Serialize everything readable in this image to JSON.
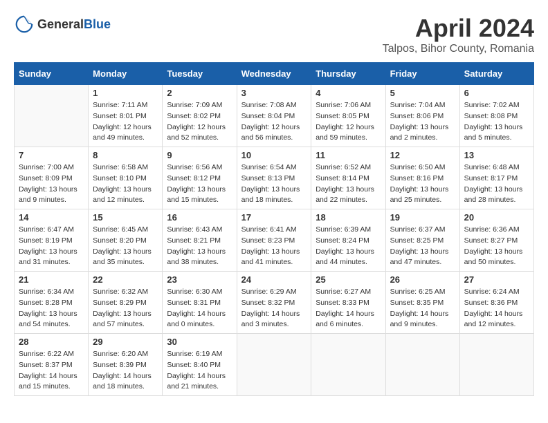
{
  "header": {
    "logo_general": "General",
    "logo_blue": "Blue",
    "month_title": "April 2024",
    "location": "Talpos, Bihor County, Romania"
  },
  "days_of_week": [
    "Sunday",
    "Monday",
    "Tuesday",
    "Wednesday",
    "Thursday",
    "Friday",
    "Saturday"
  ],
  "weeks": [
    [
      {
        "day": "",
        "sunrise": "",
        "sunset": "",
        "daylight": "",
        "empty": true
      },
      {
        "day": "1",
        "sunrise": "Sunrise: 7:11 AM",
        "sunset": "Sunset: 8:01 PM",
        "daylight": "Daylight: 12 hours and 49 minutes."
      },
      {
        "day": "2",
        "sunrise": "Sunrise: 7:09 AM",
        "sunset": "Sunset: 8:02 PM",
        "daylight": "Daylight: 12 hours and 52 minutes."
      },
      {
        "day": "3",
        "sunrise": "Sunrise: 7:08 AM",
        "sunset": "Sunset: 8:04 PM",
        "daylight": "Daylight: 12 hours and 56 minutes."
      },
      {
        "day": "4",
        "sunrise": "Sunrise: 7:06 AM",
        "sunset": "Sunset: 8:05 PM",
        "daylight": "Daylight: 12 hours and 59 minutes."
      },
      {
        "day": "5",
        "sunrise": "Sunrise: 7:04 AM",
        "sunset": "Sunset: 8:06 PM",
        "daylight": "Daylight: 13 hours and 2 minutes."
      },
      {
        "day": "6",
        "sunrise": "Sunrise: 7:02 AM",
        "sunset": "Sunset: 8:08 PM",
        "daylight": "Daylight: 13 hours and 5 minutes."
      }
    ],
    [
      {
        "day": "7",
        "sunrise": "Sunrise: 7:00 AM",
        "sunset": "Sunset: 8:09 PM",
        "daylight": "Daylight: 13 hours and 9 minutes."
      },
      {
        "day": "8",
        "sunrise": "Sunrise: 6:58 AM",
        "sunset": "Sunset: 8:10 PM",
        "daylight": "Daylight: 13 hours and 12 minutes."
      },
      {
        "day": "9",
        "sunrise": "Sunrise: 6:56 AM",
        "sunset": "Sunset: 8:12 PM",
        "daylight": "Daylight: 13 hours and 15 minutes."
      },
      {
        "day": "10",
        "sunrise": "Sunrise: 6:54 AM",
        "sunset": "Sunset: 8:13 PM",
        "daylight": "Daylight: 13 hours and 18 minutes."
      },
      {
        "day": "11",
        "sunrise": "Sunrise: 6:52 AM",
        "sunset": "Sunset: 8:14 PM",
        "daylight": "Daylight: 13 hours and 22 minutes."
      },
      {
        "day": "12",
        "sunrise": "Sunrise: 6:50 AM",
        "sunset": "Sunset: 8:16 PM",
        "daylight": "Daylight: 13 hours and 25 minutes."
      },
      {
        "day": "13",
        "sunrise": "Sunrise: 6:48 AM",
        "sunset": "Sunset: 8:17 PM",
        "daylight": "Daylight: 13 hours and 28 minutes."
      }
    ],
    [
      {
        "day": "14",
        "sunrise": "Sunrise: 6:47 AM",
        "sunset": "Sunset: 8:19 PM",
        "daylight": "Daylight: 13 hours and 31 minutes."
      },
      {
        "day": "15",
        "sunrise": "Sunrise: 6:45 AM",
        "sunset": "Sunset: 8:20 PM",
        "daylight": "Daylight: 13 hours and 35 minutes."
      },
      {
        "day": "16",
        "sunrise": "Sunrise: 6:43 AM",
        "sunset": "Sunset: 8:21 PM",
        "daylight": "Daylight: 13 hours and 38 minutes."
      },
      {
        "day": "17",
        "sunrise": "Sunrise: 6:41 AM",
        "sunset": "Sunset: 8:23 PM",
        "daylight": "Daylight: 13 hours and 41 minutes."
      },
      {
        "day": "18",
        "sunrise": "Sunrise: 6:39 AM",
        "sunset": "Sunset: 8:24 PM",
        "daylight": "Daylight: 13 hours and 44 minutes."
      },
      {
        "day": "19",
        "sunrise": "Sunrise: 6:37 AM",
        "sunset": "Sunset: 8:25 PM",
        "daylight": "Daylight: 13 hours and 47 minutes."
      },
      {
        "day": "20",
        "sunrise": "Sunrise: 6:36 AM",
        "sunset": "Sunset: 8:27 PM",
        "daylight": "Daylight: 13 hours and 50 minutes."
      }
    ],
    [
      {
        "day": "21",
        "sunrise": "Sunrise: 6:34 AM",
        "sunset": "Sunset: 8:28 PM",
        "daylight": "Daylight: 13 hours and 54 minutes."
      },
      {
        "day": "22",
        "sunrise": "Sunrise: 6:32 AM",
        "sunset": "Sunset: 8:29 PM",
        "daylight": "Daylight: 13 hours and 57 minutes."
      },
      {
        "day": "23",
        "sunrise": "Sunrise: 6:30 AM",
        "sunset": "Sunset: 8:31 PM",
        "daylight": "Daylight: 14 hours and 0 minutes."
      },
      {
        "day": "24",
        "sunrise": "Sunrise: 6:29 AM",
        "sunset": "Sunset: 8:32 PM",
        "daylight": "Daylight: 14 hours and 3 minutes."
      },
      {
        "day": "25",
        "sunrise": "Sunrise: 6:27 AM",
        "sunset": "Sunset: 8:33 PM",
        "daylight": "Daylight: 14 hours and 6 minutes."
      },
      {
        "day": "26",
        "sunrise": "Sunrise: 6:25 AM",
        "sunset": "Sunset: 8:35 PM",
        "daylight": "Daylight: 14 hours and 9 minutes."
      },
      {
        "day": "27",
        "sunrise": "Sunrise: 6:24 AM",
        "sunset": "Sunset: 8:36 PM",
        "daylight": "Daylight: 14 hours and 12 minutes."
      }
    ],
    [
      {
        "day": "28",
        "sunrise": "Sunrise: 6:22 AM",
        "sunset": "Sunset: 8:37 PM",
        "daylight": "Daylight: 14 hours and 15 minutes."
      },
      {
        "day": "29",
        "sunrise": "Sunrise: 6:20 AM",
        "sunset": "Sunset: 8:39 PM",
        "daylight": "Daylight: 14 hours and 18 minutes."
      },
      {
        "day": "30",
        "sunrise": "Sunrise: 6:19 AM",
        "sunset": "Sunset: 8:40 PM",
        "daylight": "Daylight: 14 hours and 21 minutes."
      },
      {
        "day": "",
        "sunrise": "",
        "sunset": "",
        "daylight": "",
        "empty": true
      },
      {
        "day": "",
        "sunrise": "",
        "sunset": "",
        "daylight": "",
        "empty": true
      },
      {
        "day": "",
        "sunrise": "",
        "sunset": "",
        "daylight": "",
        "empty": true
      },
      {
        "day": "",
        "sunrise": "",
        "sunset": "",
        "daylight": "",
        "empty": true
      }
    ]
  ]
}
